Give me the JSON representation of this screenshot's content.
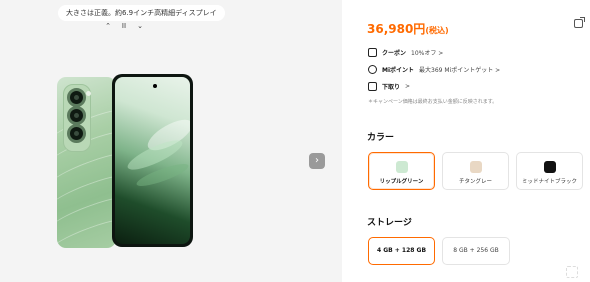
{
  "gallery": {
    "caption": "大きさは正義。約6.9インチ高精細ディスプレイ",
    "prev_icon": "chevron-up-icon",
    "pause_icon": "pause-icon",
    "next_icon": "chevron-down-icon",
    "pause_label": "II",
    "arrow_label": "›"
  },
  "product": {
    "price": "36,980円",
    "tax_note": "(税込)",
    "accent_color": "#ff6a00",
    "info_rows": [
      {
        "icon": "coupon-icon",
        "label": "クーポン",
        "value": "10%オフ >"
      },
      {
        "icon": "mi-points-icon",
        "label": "Miポイント",
        "value": "最大369 Miポイントゲット >"
      },
      {
        "icon": "trade-in-icon",
        "label": "下取り",
        "value": ">"
      }
    ],
    "note": "＊キャンペーン価格は最終お支払い金額に反映されます。"
  },
  "color_section": {
    "title": "カラー",
    "options": [
      {
        "label": "リップルグリーン",
        "swatch": "#cde9d2",
        "selected": true
      },
      {
        "label": "チタングレー",
        "swatch": "#e9d8c4",
        "selected": false
      },
      {
        "label": "ミッドナイトブラック",
        "swatch": "#111111",
        "selected": false
      }
    ]
  },
  "storage_section": {
    "title": "ストレージ",
    "options": [
      {
        "label": "4 GB + 128 GB",
        "selected": true
      },
      {
        "label": "8 GB + 256 GB",
        "selected": false
      }
    ]
  }
}
